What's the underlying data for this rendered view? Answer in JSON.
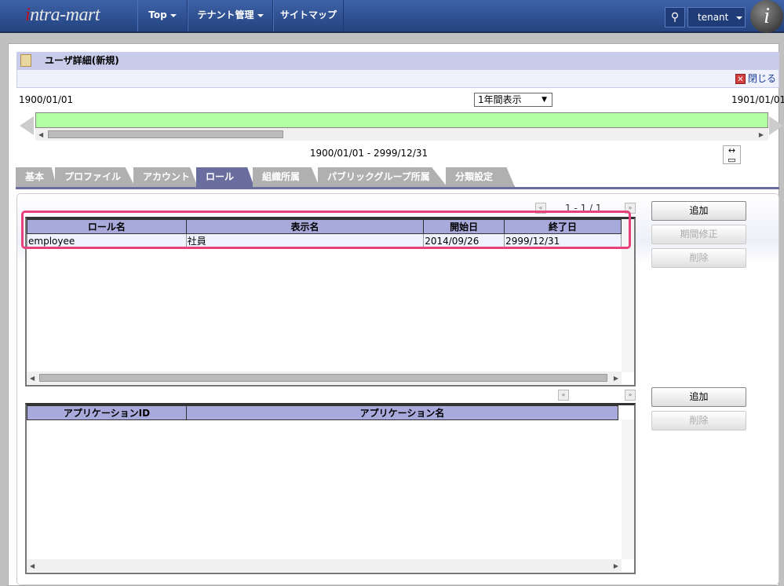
{
  "header": {
    "logo": "intra-mart",
    "nav": [
      {
        "label": "Top"
      },
      {
        "label": "テナント管理"
      },
      {
        "label": "サイトマップ"
      }
    ],
    "tenant": "tenant"
  },
  "page": {
    "title": "ユーザ詳細(新規)",
    "close": "閉じる"
  },
  "timeline": {
    "start": "1900/01/01",
    "end": "1901/01/01",
    "view": "1年間表示",
    "range": "1900/01/01 - 2999/12/31"
  },
  "tabs": [
    {
      "label": "基本"
    },
    {
      "label": "プロファイル"
    },
    {
      "label": "アカウント"
    },
    {
      "label": "ロール"
    },
    {
      "label": "組織所属"
    },
    {
      "label": "パブリックグループ所属"
    },
    {
      "label": "分類設定"
    }
  ],
  "role_table": {
    "pager": "1 - 1 / 1",
    "columns": [
      "ロール名",
      "表示名",
      "開始日",
      "終了日"
    ],
    "rows": [
      [
        "employee",
        "社員",
        "2014/09/26",
        "2999/12/31"
      ]
    ],
    "buttons": {
      "add": "追加",
      "modify": "期間修正",
      "delete": "削除"
    }
  },
  "app_table": {
    "columns": [
      "アプリケーションID",
      "アプリケーション名"
    ],
    "buttons": {
      "add": "追加",
      "delete": "削除"
    }
  }
}
